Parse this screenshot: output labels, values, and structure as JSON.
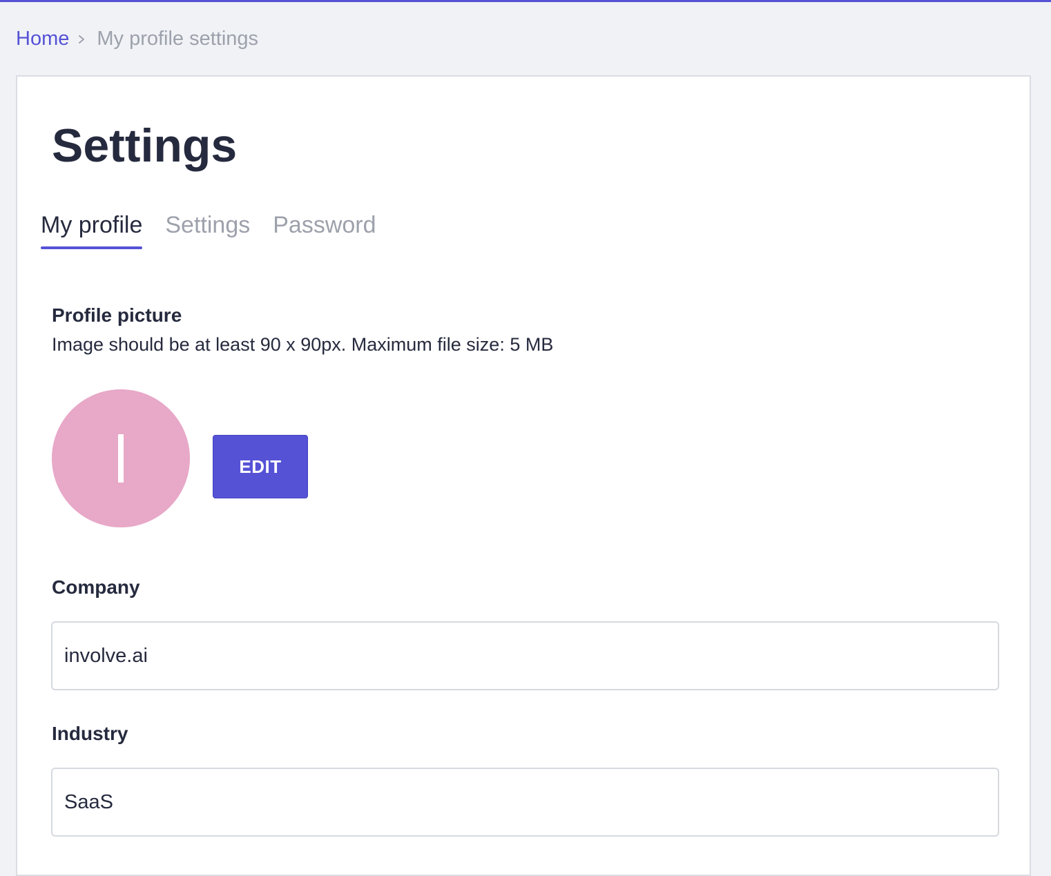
{
  "colors": {
    "accent": "#5552d6",
    "background": "#f0f2f6",
    "card": "#ffffff",
    "text": "#262a3e",
    "muted": "#9da1ab",
    "avatar": "#e8a8c8"
  },
  "breadcrumb": {
    "home": "Home",
    "separator_icon": "chevron-right-icon",
    "current": "My profile settings"
  },
  "page": {
    "title": "Settings"
  },
  "tabs": [
    {
      "label": "My profile",
      "active": true
    },
    {
      "label": "Settings",
      "active": false
    },
    {
      "label": "Password",
      "active": false
    }
  ],
  "profile_picture": {
    "heading": "Profile picture",
    "hint": "Image should be at least 90 x 90px. Maximum file size: 5 MB",
    "avatar_letter": "I",
    "edit_label": "EDIT"
  },
  "form": {
    "company": {
      "label": "Company",
      "value": "involve.ai"
    },
    "industry": {
      "label": "Industry",
      "value": "SaaS"
    }
  }
}
